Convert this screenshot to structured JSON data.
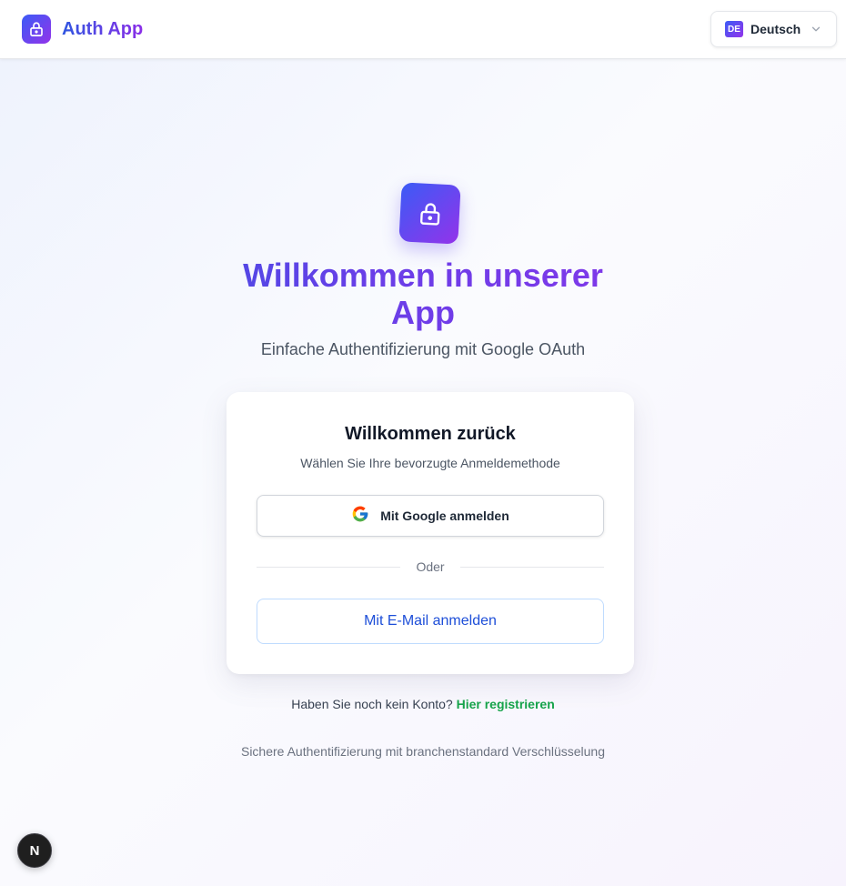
{
  "header": {
    "brand_title": "Auth App",
    "language": {
      "flag_code": "DE",
      "selected_label": "Deutsch"
    }
  },
  "hero": {
    "title": "Willkommen in unserer App",
    "subtitle": "Einfache Authentifizierung mit Google OAuth"
  },
  "card": {
    "title": "Willkommen zurück",
    "subtitle": "Wählen Sie Ihre bevorzugte Anmeldemethode",
    "google_button_label": "Mit Google anmelden",
    "divider_label": "Oder",
    "email_button_label": "Mit E-Mail anmelden"
  },
  "register": {
    "prompt": "Haben Sie noch kein Konto?",
    "link_label": "Hier registrieren"
  },
  "footer": {
    "security_note": "Sichere Authentifizierung mit branchenstandard Verschlüsselung"
  },
  "dev_badge": {
    "letter": "N"
  },
  "icons": {
    "brand": "lock-icon",
    "language_dropdown": "chevron-down-icon",
    "hero": "lock-icon",
    "google": "google-icon"
  },
  "colors": {
    "gradient_start": "#3b5bf6",
    "gradient_end": "#9333ea",
    "email_button_text": "#1d4ed8",
    "register_link": "#16a34a"
  }
}
